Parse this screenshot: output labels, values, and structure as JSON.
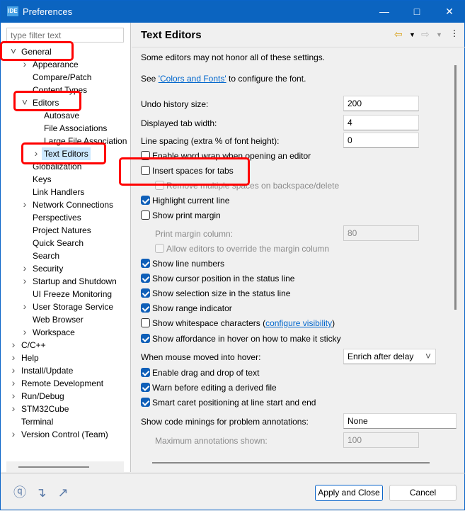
{
  "window": {
    "title": "Preferences",
    "app_icon": "IDE",
    "minimize_icon": "minimize-icon",
    "maximize_icon": "maximize-icon",
    "close_icon": "close-icon"
  },
  "sidebar": {
    "filter_placeholder": "type filter text",
    "items": [
      {
        "label": "General",
        "level": 0,
        "state": "expanded"
      },
      {
        "label": "Appearance",
        "level": 1,
        "state": "collapsed"
      },
      {
        "label": "Compare/Patch",
        "level": 1,
        "state": "leaf"
      },
      {
        "label": "Content Types",
        "level": 1,
        "state": "leaf"
      },
      {
        "label": "Editors",
        "level": 1,
        "state": "expanded"
      },
      {
        "label": "Autosave",
        "level": 2,
        "state": "leaf"
      },
      {
        "label": "File Associations",
        "level": 2,
        "state": "leaf"
      },
      {
        "label": "Large File Association",
        "level": 2,
        "state": "leaf"
      },
      {
        "label": "Text Editors",
        "level": 2,
        "state": "collapsed",
        "selected": true
      },
      {
        "label": "Globalization",
        "level": 1,
        "state": "leaf"
      },
      {
        "label": "Keys",
        "level": 1,
        "state": "leaf"
      },
      {
        "label": "Link Handlers",
        "level": 1,
        "state": "leaf"
      },
      {
        "label": "Network Connections",
        "level": 1,
        "state": "collapsed"
      },
      {
        "label": "Perspectives",
        "level": 1,
        "state": "leaf"
      },
      {
        "label": "Project Natures",
        "level": 1,
        "state": "leaf"
      },
      {
        "label": "Quick Search",
        "level": 1,
        "state": "leaf"
      },
      {
        "label": "Search",
        "level": 1,
        "state": "leaf"
      },
      {
        "label": "Security",
        "level": 1,
        "state": "collapsed"
      },
      {
        "label": "Startup and Shutdown",
        "level": 1,
        "state": "collapsed"
      },
      {
        "label": "UI Freeze Monitoring",
        "level": 1,
        "state": "leaf"
      },
      {
        "label": "User Storage Service",
        "level": 1,
        "state": "collapsed"
      },
      {
        "label": "Web Browser",
        "level": 1,
        "state": "leaf"
      },
      {
        "label": "Workspace",
        "level": 1,
        "state": "collapsed"
      },
      {
        "label": "C/C++",
        "level": 0,
        "state": "collapsed"
      },
      {
        "label": "Help",
        "level": 0,
        "state": "collapsed"
      },
      {
        "label": "Install/Update",
        "level": 0,
        "state": "collapsed"
      },
      {
        "label": "Remote Development",
        "level": 0,
        "state": "collapsed"
      },
      {
        "label": "Run/Debug",
        "level": 0,
        "state": "collapsed"
      },
      {
        "label": "STM32Cube",
        "level": 0,
        "state": "collapsed"
      },
      {
        "label": "Terminal",
        "level": 0,
        "state": "leaf"
      },
      {
        "label": "Version Control (Team)",
        "level": 0,
        "state": "collapsed"
      }
    ]
  },
  "page": {
    "title": "Text Editors",
    "nav_icons": [
      "back-arrow-icon",
      "dropdown-icon",
      "forward-arrow-icon",
      "dropdown-icon",
      "more-icon"
    ],
    "note": "Some editors may not honor all of these settings.",
    "see_prefix": "See ",
    "see_link": "'Colors and Fonts'",
    "see_suffix": " to configure the font.",
    "settings": [
      {
        "type": "field",
        "label": "Undo history size:",
        "value": "200"
      },
      {
        "type": "field",
        "label": "Displayed tab width:",
        "value": "4"
      },
      {
        "type": "field",
        "label": "Line spacing (extra % of font height):",
        "value": "0"
      },
      {
        "type": "check",
        "label": "Enable word wrap when opening an editor",
        "checked": false
      },
      {
        "type": "check",
        "label": "Insert spaces for tabs",
        "checked": false
      },
      {
        "type": "check",
        "label": "Remove multiple spaces on backspace/delete",
        "checked": false,
        "disabled": true,
        "indent": true
      },
      {
        "type": "check",
        "label": "Highlight current line",
        "checked": true
      },
      {
        "type": "check",
        "label": "Show print margin",
        "checked": false
      },
      {
        "type": "field",
        "label": "Print margin column:",
        "value": "80",
        "disabled": true,
        "indent": true
      },
      {
        "type": "check",
        "label": "Allow editors to override the margin column",
        "checked": false,
        "disabled": true,
        "indent": true
      },
      {
        "type": "check",
        "label": "Show line numbers",
        "checked": true
      },
      {
        "type": "check",
        "label": "Show cursor position in the status line",
        "checked": true
      },
      {
        "type": "check",
        "label": "Show selection size in the status line",
        "checked": true
      },
      {
        "type": "check",
        "label": "Show range indicator",
        "checked": true
      },
      {
        "type": "check",
        "label": "Show whitespace characters (",
        "link": "configure visibility",
        "after": ")",
        "checked": false
      },
      {
        "type": "check",
        "label": "Show affordance in hover on how to make it sticky",
        "checked": true
      },
      {
        "type": "select",
        "label": "When mouse moved into hover:",
        "value": "Enrich after delay"
      },
      {
        "type": "check",
        "label": "Enable drag and drop of text",
        "checked": true
      },
      {
        "type": "check",
        "label": "Warn before editing a derived file",
        "checked": true
      },
      {
        "type": "check",
        "label": "Smart caret positioning at line start and end",
        "checked": true
      },
      {
        "type": "select2",
        "label": "Show code minings for problem annotations:",
        "value": "None"
      },
      {
        "type": "field",
        "label": "Maximum annotations shown:",
        "value": "100",
        "disabled": true,
        "indent": true
      }
    ]
  },
  "footer": {
    "icons": [
      "help-icon",
      "import-icon",
      "export-icon"
    ],
    "apply_close": "Apply and Close",
    "cancel": "Cancel"
  },
  "colors": {
    "titlebar": "#0b64c0",
    "selection": "#cce8ff",
    "checkbox": "#0f5fb8",
    "annotation": "#ff0000",
    "link": "#0066cc"
  }
}
